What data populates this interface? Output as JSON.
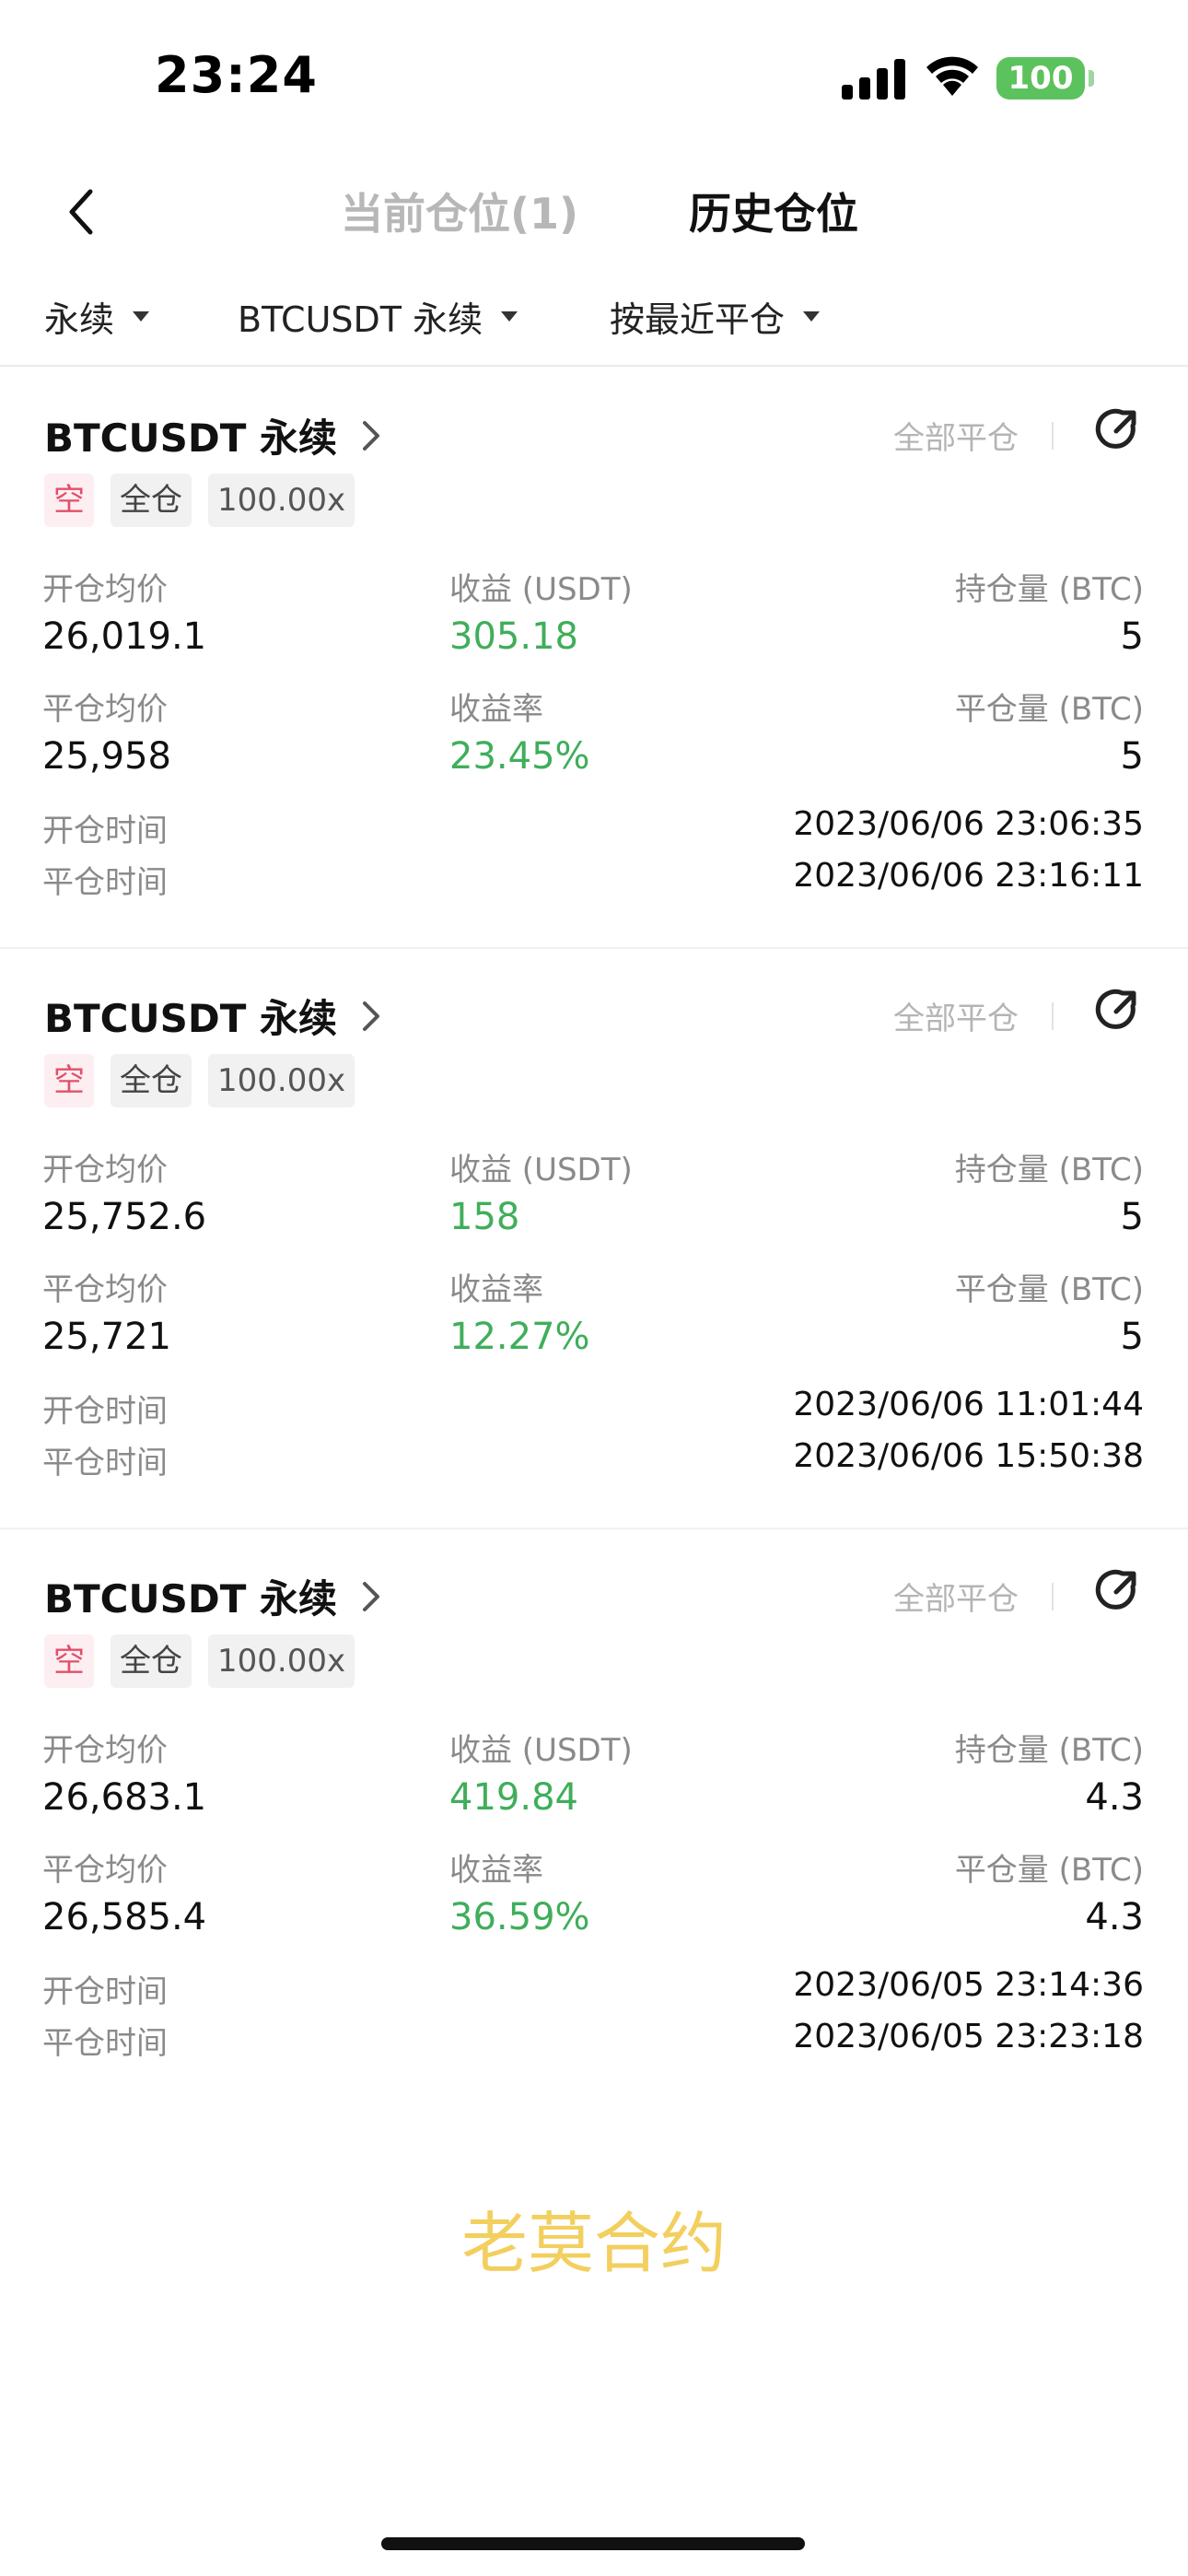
{
  "status_bar": {
    "time": "23:24",
    "battery": "100"
  },
  "nav": {
    "tab_current": "当前仓位(1)",
    "tab_history": "历史仓位"
  },
  "filters": [
    {
      "label": "永续"
    },
    {
      "label": "BTCUSDT 永续"
    },
    {
      "label": "按最近平仓"
    }
  ],
  "labels": {
    "close_all": "全部平仓",
    "open_avg": "开仓均价",
    "pnl": "收益 (USDT)",
    "hold_qty": "持仓量 (BTC)",
    "close_avg": "平仓均价",
    "pnl_rate": "收益率",
    "close_qty": "平仓量 (BTC)",
    "open_time": "开仓时间",
    "close_time": "平仓时间"
  },
  "positions": [
    {
      "symbol": "BTCUSDT 永续",
      "side": "空",
      "margin_mode": "全仓",
      "leverage": "100.00x",
      "open_avg": "26,019.1",
      "pnl": "305.18",
      "hold_qty": "5",
      "close_avg": "25,958",
      "pnl_rate": "23.45%",
      "close_qty": "5",
      "open_time": "2023/06/06 23:06:35",
      "close_time": "2023/06/06 23:16:11"
    },
    {
      "symbol": "BTCUSDT 永续",
      "side": "空",
      "margin_mode": "全仓",
      "leverage": "100.00x",
      "open_avg": "25,752.6",
      "pnl": "158",
      "hold_qty": "5",
      "close_avg": "25,721",
      "pnl_rate": "12.27%",
      "close_qty": "5",
      "open_time": "2023/06/06 11:01:44",
      "close_time": "2023/06/06 15:50:38"
    },
    {
      "symbol": "BTCUSDT 永续",
      "side": "空",
      "margin_mode": "全仓",
      "leverage": "100.00x",
      "open_avg": "26,683.1",
      "pnl": "419.84",
      "hold_qty": "4.3",
      "close_avg": "26,585.4",
      "pnl_rate": "36.59%",
      "close_qty": "4.3",
      "open_time": "2023/06/05 23:14:36",
      "close_time": "2023/06/05 23:23:18"
    }
  ],
  "watermark": "老莫合约",
  "colors": {
    "profit_green": "#3fae5a",
    "short_red": "#e2506a",
    "battery_green": "#5cc25d",
    "watermark_yellow": "#f2cf5e"
  }
}
